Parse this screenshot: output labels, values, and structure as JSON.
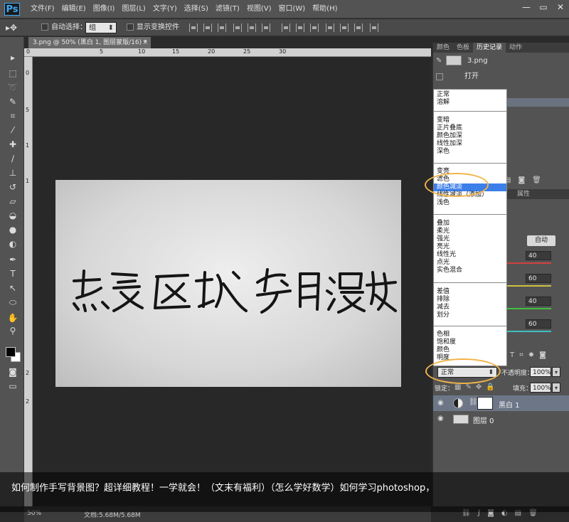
{
  "app": {
    "logo": "Ps"
  },
  "menu": [
    "文件(F)",
    "编辑(E)",
    "图像(I)",
    "图层(L)",
    "文字(Y)",
    "选择(S)",
    "滤镜(T)",
    "视图(V)",
    "窗口(W)",
    "帮助(H)"
  ],
  "window_controls": {
    "minimize": "—",
    "restore": "▭",
    "close": "✕"
  },
  "options": {
    "auto_select_label": "自动选择：",
    "auto_select_value": "组",
    "show_transform_label": "显示变换控件"
  },
  "document": {
    "tab_title": "3.png @ 50% (黑白 1, 图层蒙版/16) *",
    "ruler_top_ticks": [
      "0",
      "5",
      "10",
      "15",
      "20",
      "25",
      "30"
    ],
    "ruler_left_ticks": [
      "0",
      "5",
      "1",
      "1",
      "2",
      "2"
    ]
  },
  "history_panel": {
    "tabs": [
      "颜色",
      "色板",
      "历史记录",
      "动作"
    ],
    "snapshot_name": "3.png",
    "steps": [
      "打开"
    ]
  },
  "adjustments": {
    "tab": "属性",
    "auto_label": "自动",
    "sliders": [
      {
        "value": "40",
        "color": "#d04040"
      },
      {
        "value": "60",
        "color": "#d0c040"
      },
      {
        "value": "40",
        "color": "#40c040"
      },
      {
        "value": "60",
        "color": "#40c0c0"
      }
    ]
  },
  "blend_modes": {
    "groups": [
      [
        "正常",
        "溶解"
      ],
      [
        "变暗",
        "正片叠底",
        "颜色加深",
        "线性加深",
        "深色"
      ],
      [
        "变亮",
        "滤色",
        "颜色减淡",
        "线性减淡（添加）",
        "浅色"
      ],
      [
        "叠加",
        "柔光",
        "强光",
        "亮光",
        "线性光",
        "点光",
        "实色混合"
      ],
      [
        "差值",
        "排除",
        "减去",
        "划分"
      ],
      [
        "色相",
        "饱和度",
        "颜色",
        "明度"
      ]
    ],
    "highlighted": "颜色减淡"
  },
  "layers_panel": {
    "blend_mode": "正常",
    "opacity_label": "不透明度：",
    "opacity_value": "100%",
    "lock_label": "锁定：",
    "fill_label": "填充：",
    "fill_value": "100%",
    "layers": [
      {
        "name": "黑白 1",
        "selected": true
      },
      {
        "name": "图层 0",
        "selected": false
      }
    ]
  },
  "status": {
    "zoom": "50%",
    "doc_size": "文档:5.68M/5.68M"
  },
  "caption": "如何制作手写背景图？超详细教程！一学就会！（文末有福利）（怎么学好数学）如何学习photoshop，",
  "accent_colors": {
    "annotation_ring": "#f0b44a",
    "highlight": "#3d7fe8"
  }
}
